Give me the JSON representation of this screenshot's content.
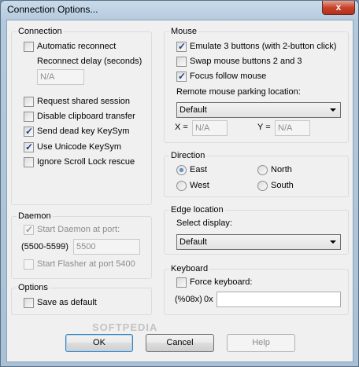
{
  "window": {
    "title": "Connection Options...",
    "close_glyph": "x"
  },
  "connection": {
    "title": "Connection",
    "automatic_reconnect": {
      "label": "Automatic reconnect",
      "checked": false
    },
    "reconnect_delay_label": "Reconnect delay (seconds)",
    "reconnect_delay_value": "N/A",
    "request_shared_session": {
      "label": "Request shared session",
      "checked": false
    },
    "disable_clipboard_transfer": {
      "label": "Disable clipboard transfer",
      "checked": false
    },
    "send_dead_key": {
      "label": "Send dead key KeySym",
      "checked": true
    },
    "use_unicode_keysym": {
      "label": "Use Unicode KeySym",
      "checked": true
    },
    "ignore_scroll_lock": {
      "label": "Ignore Scroll Lock rescue",
      "checked": false
    }
  },
  "mouse": {
    "title": "Mouse",
    "emulate_3_buttons": {
      "label": "Emulate 3 buttons (with 2-button click)",
      "checked": true
    },
    "swap_buttons": {
      "label": "Swap mouse buttons 2 and 3",
      "checked": false
    },
    "focus_follow_mouse": {
      "label": "Focus follow mouse",
      "checked": true
    },
    "parking_location_label": "Remote mouse parking location:",
    "parking_location_value": "Default",
    "x_label": "X =",
    "x_value": "N/A",
    "y_label": "Y =",
    "y_value": "N/A"
  },
  "direction": {
    "title": "Direction",
    "east": "East",
    "north": "North",
    "west": "West",
    "south": "South",
    "selected": "East"
  },
  "daemon": {
    "title": "Daemon",
    "start_daemon": {
      "label": "Start Daemon at port:",
      "checked": true
    },
    "port_range_label": "(5500-5599)",
    "port_value": "5500",
    "start_flasher": {
      "label": "Start Flasher at port 5400",
      "checked": false
    }
  },
  "edge_location": {
    "title": "Edge location",
    "select_display_label": "Select display:",
    "select_display_value": "Default"
  },
  "options": {
    "title": "Options",
    "save_as_default": {
      "label": "Save as default",
      "checked": false
    }
  },
  "keyboard": {
    "title": "Keyboard",
    "force_keyboard": {
      "label": "Force keyboard:",
      "checked": false
    },
    "format_label": "(%08x)",
    "hex_prefix": "0x",
    "keyboard_value": ""
  },
  "buttons": {
    "ok": "OK",
    "cancel": "Cancel",
    "help": "Help"
  },
  "watermark": "SOFTPEDIA"
}
